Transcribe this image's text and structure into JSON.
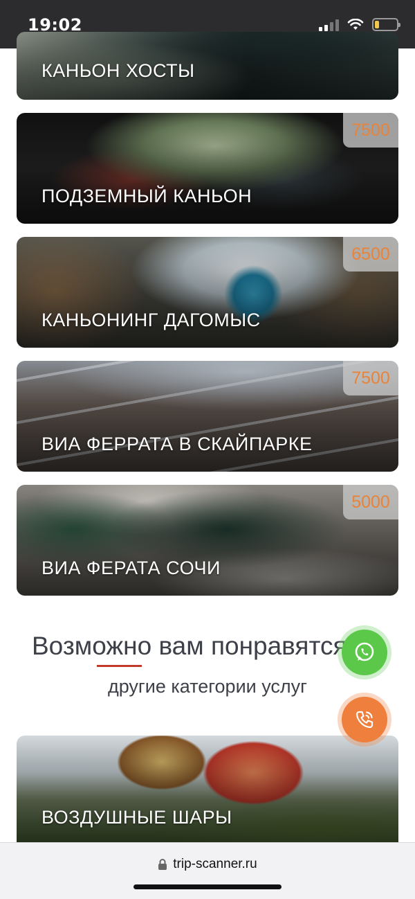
{
  "status_bar": {
    "time": "19:02",
    "icons": [
      "signal-icon",
      "wifi-icon",
      "battery-icon"
    ],
    "battery_level": 0.2
  },
  "tours": [
    {
      "title": "КАНЬОН ХОСТЫ",
      "price": ""
    },
    {
      "title": "ПОДЗЕМНЫЙ КАНЬОН",
      "price": "7500"
    },
    {
      "title": "КАНЬОНИНГ ДАГОМЫС",
      "price": "6500"
    },
    {
      "title": "ВИА ФЕРРАТА В СКАЙПАРКЕ",
      "price": "7500"
    },
    {
      "title": "ВИА ФЕРАТА СОЧИ",
      "price": "5000"
    }
  ],
  "recommendations": {
    "heading": "Возможно вам понравятся",
    "subheading": "другие категории услуг",
    "categories": [
      {
        "title": "ВОЗДУШНЫЕ ШАРЫ"
      }
    ]
  },
  "floating_buttons": {
    "whatsapp_icon": "whatsapp-icon",
    "phone_icon": "phone-icon",
    "whatsapp_color": "#5cc84a",
    "phone_color": "#ee7f3d"
  },
  "browser": {
    "url": "trip-scanner.ru",
    "lock_icon": "lock-icon"
  },
  "colors": {
    "price": "#e8833a",
    "heading": "#3d4048",
    "accent_underline": "#c0392b"
  }
}
